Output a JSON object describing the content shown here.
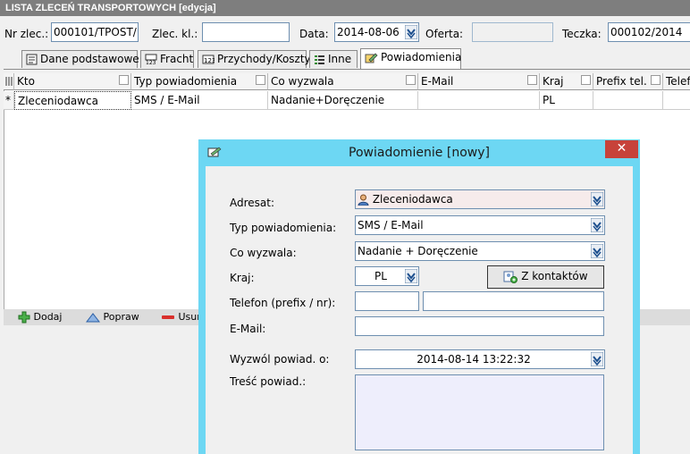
{
  "window": {
    "title": "LISTA ZLECEŃ TRANSPORTOWYCH  [edycja]"
  },
  "header": {
    "nr_zlec_label": "Nr zlec.:",
    "nr_zlec_value": "000101/TPOST/'",
    "zlec_kl_label": "Zlec. kl.:",
    "zlec_kl_value": "",
    "data_label": "Data:",
    "data_value": "2014-08-06",
    "oferta_label": "Oferta:",
    "oferta_value": "",
    "teczka_label": "Teczka:",
    "teczka_value": "000102/2014"
  },
  "tabs": [
    {
      "label": "Dane podstawowe",
      "icon": "document-icon"
    },
    {
      "label": "Fracht",
      "icon": "freight-icon"
    },
    {
      "label": "Przychody/Koszty",
      "icon": "money-icon"
    },
    {
      "label": "Inne",
      "icon": "list-icon"
    },
    {
      "label": "Powiadomienia",
      "icon": "notification-icon",
      "active": true
    }
  ],
  "grid": {
    "columns": [
      "Kto",
      "Typ powiadomienia",
      "Co wyzwala",
      "E-Mail",
      "Kraj",
      "Prefix tel.",
      "Telef"
    ],
    "rows": [
      {
        "marker": "*",
        "cells": [
          "Zleceniodawca",
          "SMS / E-Mail",
          "Nadanie+Doręczenie",
          "",
          "PL",
          "",
          ""
        ]
      }
    ]
  },
  "toolbar": {
    "add": "Dodaj",
    "edit": "Popraw",
    "delete": "Usuń"
  },
  "dialog": {
    "title": "Powiadomienie [nowy]",
    "close": "✕",
    "adresat_label": "Adresat:",
    "adresat_value": "Zleceniodawca",
    "typ_label": "Typ powiadomienia:",
    "typ_value": "SMS / E-Mail",
    "co_label": "Co wyzwala:",
    "co_value": "Nadanie + Doręczenie",
    "kraj_label": "Kraj:",
    "kraj_value": "PL",
    "contacts_button": "Z kontaktów",
    "telefon_label": "Telefon (prefix / nr):",
    "prefix_value": "",
    "nr_value": "",
    "email_label": "E-Mail:",
    "email_value": "",
    "wyzwol_label": "Wyzwól powiad. o:",
    "wyzwol_value": "2014-08-14 13:22:32",
    "tresc_label": "Treść powiad.:",
    "tresc_value": ""
  },
  "colors": {
    "title_bar": "#7e7e7e",
    "dialog_frame": "#6dd7f3",
    "close_button": "#c7423a",
    "field_border": "#6e8fb0",
    "textarea_bg": "#eeeefc"
  }
}
